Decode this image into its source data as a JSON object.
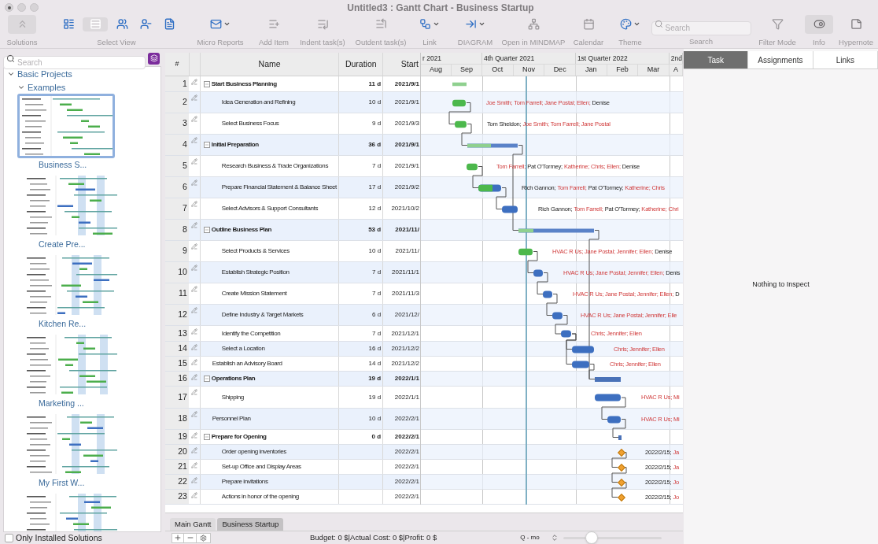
{
  "window": {
    "title": "Untitled3 : Gantt Chart - Business Startup"
  },
  "toolbar": {
    "items": [
      {
        "kind": "boxed",
        "label": "Solutions"
      },
      {
        "kind": "views",
        "label": "Select View",
        "views": [
          {
            "selected": false
          },
          {
            "selected": true
          },
          {
            "selected": false
          },
          {
            "selected": false
          },
          {
            "selected": false
          }
        ]
      },
      {
        "kind": "menu",
        "label": "Micro Reports"
      },
      {
        "kind": "button",
        "label": "Add Item"
      },
      {
        "kind": "button",
        "label": "Indent task(s)"
      },
      {
        "kind": "button",
        "label": "Outdent task(s)"
      },
      {
        "kind": "menu",
        "label": "Link"
      },
      {
        "kind": "menu",
        "label": "DIAGRAM"
      },
      {
        "kind": "button",
        "label": "Open in MINDMAP"
      },
      {
        "kind": "button",
        "label": "Calendar"
      },
      {
        "kind": "menu",
        "label": "Theme"
      },
      {
        "kind": "search",
        "label": "Search",
        "placeholder": "Search"
      },
      {
        "kind": "button",
        "label": "Filter Mode"
      },
      {
        "kind": "boxed",
        "label": "Info"
      },
      {
        "kind": "button",
        "label": "Hypernote"
      }
    ]
  },
  "sidebar": {
    "search": {
      "placeholder": "Search"
    },
    "tree": [
      {
        "label": "Basic Projects",
        "expanded": true,
        "children": [
          {
            "label": "Examples",
            "expanded": true,
            "thumbnails": [
              {
                "label": "Business S...",
                "selected": true
              },
              {
                "label": "Create Pre...",
                "selected": false
              },
              {
                "label": "Kitchen Re...",
                "selected": false
              },
              {
                "label": "Marketing ...",
                "selected": false
              },
              {
                "label": "My First W...",
                "selected": false
              },
              {
                "selected": false
              }
            ]
          }
        ]
      }
    ],
    "only_installed": {
      "label": "Only Installed Solutions",
      "checked": false
    }
  },
  "table": {
    "columns": [
      "#",
      "Name",
      "Duration",
      "Start"
    ],
    "rows": [
      {
        "number": "1",
        "kind": "summary",
        "expanded": true,
        "name": "Start Business Planning",
        "duration": "11 d",
        "start": "2021/9/1",
        "level": 1,
        "children": [
          {
            "number": "2",
            "kind": "task",
            "name": "Idea Generation and Refining",
            "duration": "10 d",
            "start": "2021/9/1",
            "level": 1,
            "resources": [
              {
                "text": "Joe Smith; Tom Farrell; Jane Postal; Ellen;",
                "highlighted": true
              },
              {
                "text": "Denise",
                "highlighted": false
              }
            ]
          },
          {
            "number": "3",
            "kind": "task",
            "name": "Select Business Focus",
            "duration": "9 d",
            "start": "2021/9/3",
            "level": 1,
            "resources": [
              {
                "text": "Tom Sheldon;",
                "highlighted": false
              },
              {
                "text": "Joe Smith; Tom Farrell; Jane Postal",
                "highlighted": true
              }
            ]
          }
        ]
      },
      {
        "number": "4",
        "kind": "summary",
        "expanded": true,
        "name": "Initial Preparation",
        "duration": "36 d",
        "start": "2021/9/1",
        "level": 0.47,
        "children": [
          {
            "number": "5",
            "kind": "task",
            "name": "Research Business & Trade Organizations",
            "duration": "7 d",
            "start": "2021/9/1",
            "level": 1,
            "resources": [
              {
                "text": "Tom Farrell;",
                "highlighted": true
              },
              {
                "text": "Pat O'Tormey;",
                "highlighted": false
              },
              {
                "text": "Katherine; Chris; Ellen;",
                "highlighted": true
              },
              {
                "text": "Denise",
                "highlighted": false
              }
            ]
          },
          {
            "number": "6",
            "kind": "task",
            "name": "Prepare Financial Statement & Balance Sheet",
            "duration": "17 d",
            "start": "2021/9/2",
            "level": 0.62,
            "resources": [
              {
                "text": "Rich Gannon;",
                "highlighted": false
              },
              {
                "text": "Tom Farrell;",
                "highlighted": true
              },
              {
                "text": "Pat O'Tormey;",
                "highlighted": false
              },
              {
                "text": "Katherine; Chris",
                "highlighted": true
              }
            ]
          },
          {
            "number": "7",
            "kind": "task",
            "name": "Select Advisors & Support Consultants",
            "duration": "12 d",
            "start": "2021/10/2",
            "level": 0,
            "resources": [
              {
                "text": "Rich Gannon;",
                "highlighted": false
              },
              {
                "text": "Tom Farrell;",
                "highlighted": true
              },
              {
                "text": "Pat O'Tormey;",
                "highlighted": false
              },
              {
                "text": "Katherine; Chri",
                "highlighted": true
              }
            ]
          }
        ]
      },
      {
        "number": "8",
        "kind": "summary",
        "expanded": true,
        "name": "Outline Business Plan",
        "duration": "53 d",
        "start": "2021/11/",
        "level": 0.2,
        "children": [
          {
            "number": "9",
            "kind": "task",
            "name": "Select Products & Services",
            "duration": "10 d",
            "start": "2021/11/",
            "level": 1,
            "resources": [
              {
                "text": "HVAC R Us; Jane Postal; Jennifer; Ellen;",
                "highlighted": true
              },
              {
                "text": "Denise",
                "highlighted": false
              }
            ]
          },
          {
            "number": "10",
            "kind": "task",
            "name": "Establish Strategic Position",
            "duration": "7 d",
            "start": "2021/11/1",
            "level": 0,
            "resources": [
              {
                "text": "HVAC R Us; Jane Postal; Jennifer; Ellen;",
                "highlighted": true
              },
              {
                "text": "Denis",
                "highlighted": false
              }
            ]
          },
          {
            "number": "11",
            "kind": "task",
            "name": "Create Mission Statement",
            "duration": "7 d",
            "start": "2021/11/3",
            "level": 0,
            "resources": [
              {
                "text": "HVAC R Us; Jane Postal; Jennifer; Ellen;",
                "highlighted": true
              },
              {
                "text": "D",
                "highlighted": false
              }
            ]
          },
          {
            "number": "12",
            "kind": "task",
            "name": "Define Industry & Target Markets",
            "duration": "6 d",
            "start": "2021/12/",
            "level": 0,
            "resources": [
              {
                "text": "HVAC R Us; Jane Postal; Jennifer; Elle",
                "highlighted": true
              }
            ]
          },
          {
            "number": "13",
            "kind": "task",
            "name": "Identify the Competition",
            "duration": "7 d",
            "start": "2021/12/1",
            "level": 0,
            "resources": [
              {
                "text": "Chris; Jennifer; Ellen",
                "highlighted": true
              }
            ]
          },
          {
            "number": "14",
            "kind": "task",
            "name": "Select a Location",
            "duration": "16 d",
            "start": "2021/12/2",
            "level": 0,
            "resources": [
              {
                "text": "Chris; Jennifer; Ellen",
                "highlighted": true
              }
            ]
          }
        ]
      },
      {
        "number": "15",
        "kind": "task",
        "name": "Establish an Advisory Board",
        "duration": "14 d",
        "start": "2021/12/2",
        "level": 0,
        "resources": [
          {
            "text": "Chris; Jennifer; Ellen",
            "highlighted": true
          }
        ]
      },
      {
        "number": "16",
        "kind": "summary",
        "expanded": true,
        "name": "Operations Plan",
        "duration": "19 d",
        "start": "2022/1/1",
        "children": [
          {
            "number": "17",
            "kind": "task",
            "name": "Shipping",
            "duration": "19 d",
            "start": "2022/1/1",
            "level": 0,
            "resources": [
              {
                "text": "HVAC R Us; Mi",
                "highlighted": true
              }
            ]
          }
        ]
      },
      {
        "number": "18",
        "kind": "task",
        "name": "Personnel Plan",
        "duration": "10 d",
        "start": "2022/2/1",
        "level": 0,
        "resources": [
          {
            "text": "HVAC R Us; Mi",
            "highlighted": true
          }
        ]
      },
      {
        "number": "19",
        "kind": "summary",
        "expanded": true,
        "name": "Prepare for Opening",
        "duration": "0 d",
        "start": "2022/2/1",
        "children": [
          {
            "number": "20",
            "kind": "milestone",
            "name": "Order opening inventories",
            "start": "2022/2/1",
            "resources": [
              {
                "text": "2022/2/15;",
                "highlighted": false
              },
              {
                "text": "Ja",
                "highlighted": true
              }
            ]
          },
          {
            "number": "21",
            "kind": "milestone",
            "name": "Set-up Office and Display Areas",
            "start": "2022/2/1",
            "resources": [
              {
                "text": "2022/2/15;",
                "highlighted": false
              },
              {
                "text": "Ja",
                "highlighted": true
              }
            ]
          },
          {
            "number": "22",
            "kind": "milestone",
            "name": "Prepare invitations",
            "start": "2022/2/1",
            "resources": [
              {
                "text": "2022/2/15;",
                "highlighted": false
              },
              {
                "text": "Jo",
                "highlighted": true
              }
            ]
          },
          {
            "number": "23",
            "kind": "milestone",
            "name": "Actions in honor of the opening",
            "start": "2022/2/1",
            "resources": [
              {
                "text": "2022/2/15;",
                "highlighted": false
              },
              {
                "text": "Jo",
                "highlighted": true
              }
            ]
          }
        ]
      }
    ]
  },
  "gantt": {
    "quarters": [
      "r 2021",
      "4th Quarter 2021",
      "1st Quarter 2022",
      "2nd"
    ],
    "months": [
      "Aug",
      "Sep",
      "Oct",
      "Nov",
      "Dec",
      "Jan",
      "Feb",
      "Mar",
      "A"
    ]
  },
  "sheet_tabs": [
    {
      "label": "Main Gantt",
      "selected": false
    },
    {
      "label": "Business Startup",
      "selected": true
    }
  ],
  "status_bar": {
    "totals": "Budget: 0 $|Actual Cost: 0 $|Profit: 0 $",
    "scale": "Q - mo",
    "zoom": {
      "level": 0.29
    }
  },
  "inspector": {
    "tabs": [
      {
        "label": "Task",
        "selected": true
      },
      {
        "label": "Assignments",
        "selected": false
      },
      {
        "label": "Links",
        "selected": false
      }
    ],
    "message": "Nothing to Inspect"
  }
}
